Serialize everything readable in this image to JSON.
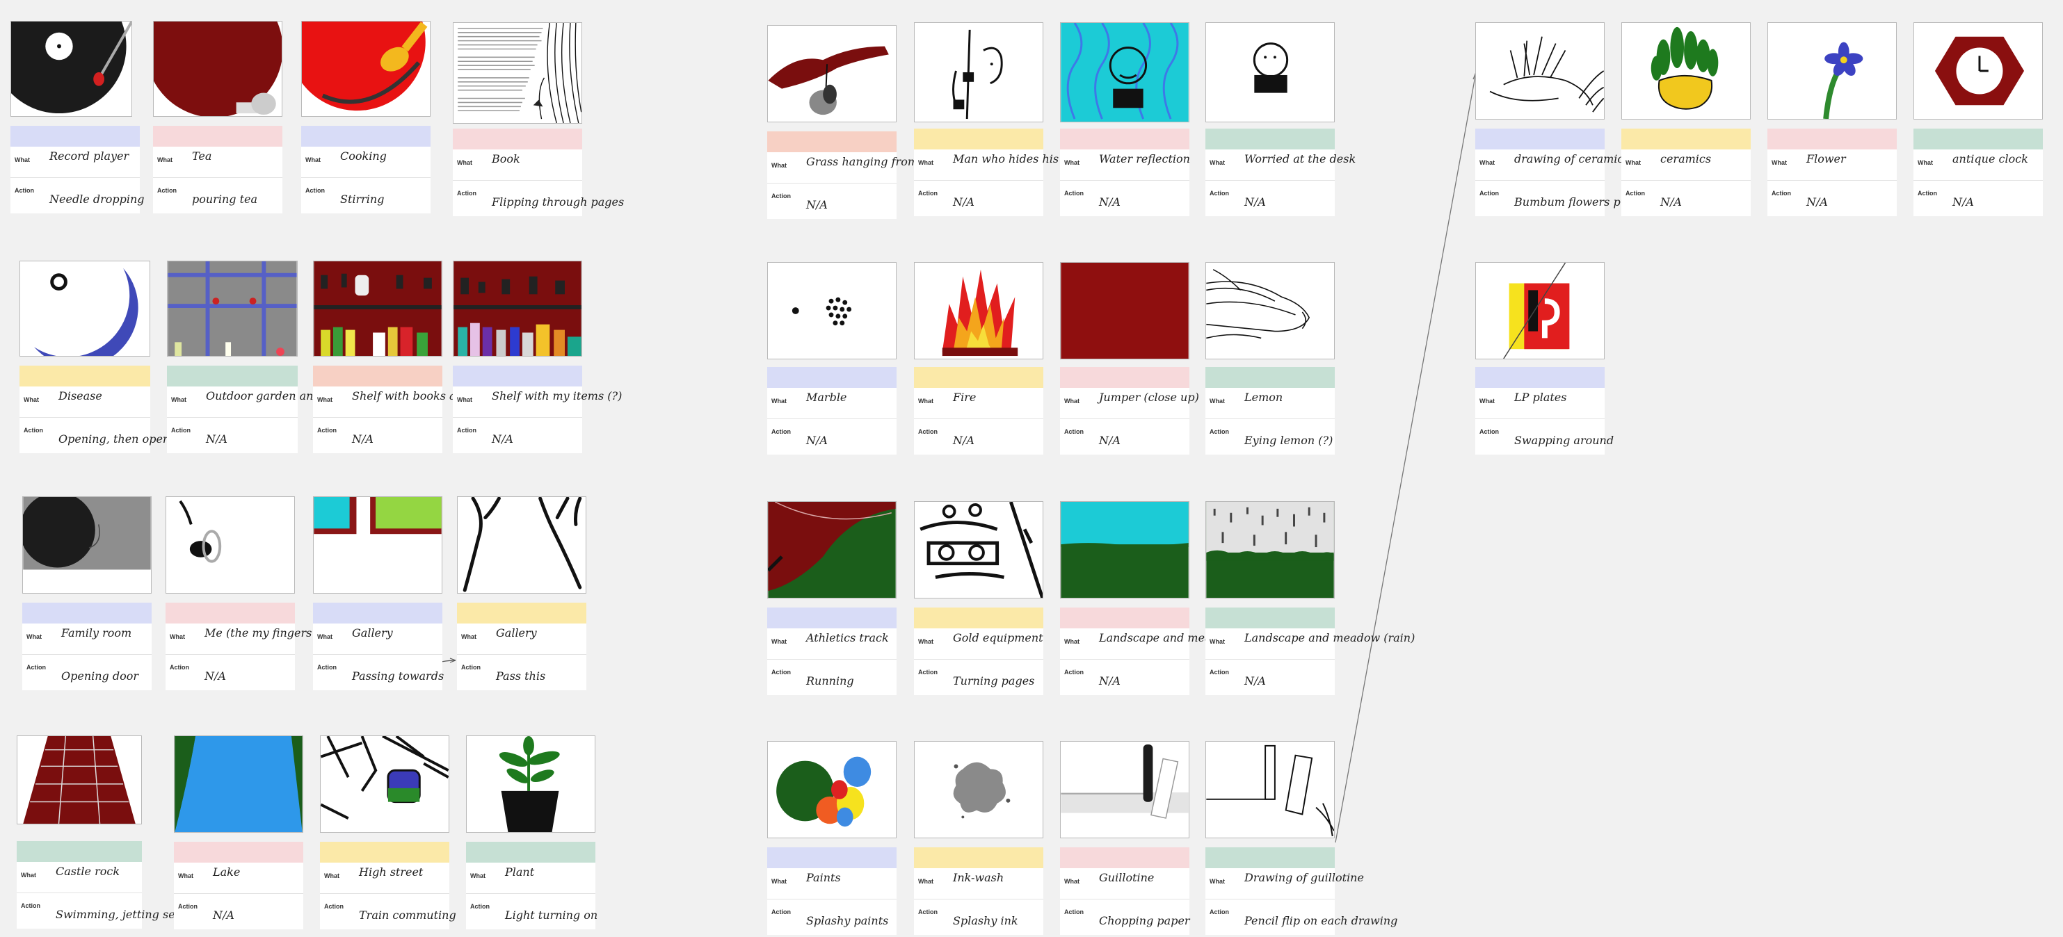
{
  "labels": {
    "what": "What",
    "action": "Action"
  },
  "colors": {
    "blue": "#d8dcf7",
    "pink": "#f7d9db",
    "yellow": "#fbe9a8",
    "green": "#c6e0d4",
    "salmon": "#f7d0c4",
    "maroon": "#8b0f0f",
    "canvas": "#f1f1f1"
  },
  "cards": [
    {
      "id": "c1",
      "what": "Record player",
      "action": "Needle dropping",
      "band": "blue",
      "icon": "record-player-drawing"
    },
    {
      "id": "c2",
      "what": "Tea",
      "action": "pouring tea",
      "band": "pink",
      "icon": "teapot-drawing"
    },
    {
      "id": "c3",
      "what": "Cooking",
      "action": "Stirring",
      "band": "blue",
      "icon": "cooking-pan-drawing"
    },
    {
      "id": "c4",
      "what": "Book",
      "action": "Flipping through pages",
      "band": "pink",
      "icon": "book-pages-drawing"
    },
    {
      "id": "c5",
      "what": "Disease",
      "action": "Opening, then opening brushy",
      "band": "yellow",
      "icon": "disease-drawing"
    },
    {
      "id": "c6",
      "what": "Outdoor garden and bag",
      "action": "N/A",
      "band": "green",
      "icon": "garden-shelf-drawing"
    },
    {
      "id": "c7",
      "what": "Shelf with books and bottles",
      "action": "N/A",
      "band": "salmon",
      "icon": "shelf-drawing"
    },
    {
      "id": "c8",
      "what": "Shelf with my items (?)",
      "action": "N/A",
      "band": "blue",
      "icon": "shelf-items-drawing"
    },
    {
      "id": "c9",
      "what": "Family room",
      "action": "Opening door",
      "band": "blue",
      "icon": "family-room-drawing"
    },
    {
      "id": "c10",
      "what": "Me (the my fingers (ring))",
      "action": "N/A",
      "band": "pink",
      "icon": "ear-drawing"
    },
    {
      "id": "c11",
      "what": "Gallery",
      "action": "Passing towards",
      "band": "blue",
      "icon": "gallery-drawing"
    },
    {
      "id": "c12",
      "what": "Gallery",
      "action": "Pass this",
      "band": "yellow",
      "icon": "gallery-lines-drawing"
    },
    {
      "id": "c13",
      "what": "Castle rock",
      "action": "Swimming, jetting sea/bubbles",
      "band": "green",
      "icon": "castle-rock-drawing"
    },
    {
      "id": "c14",
      "what": "Lake",
      "action": "N/A",
      "band": "pink",
      "icon": "lake-drawing"
    },
    {
      "id": "c15",
      "what": "High street",
      "action": "Train commuting",
      "band": "yellow",
      "icon": "high-street-drawing"
    },
    {
      "id": "c16",
      "what": "Plant",
      "action": "Light turning on",
      "band": "green",
      "icon": "plant-pot-drawing"
    },
    {
      "id": "c17",
      "what": "Grass hanging from tree",
      "action": "N/A",
      "band": "salmon",
      "icon": "hanging-tree-drawing"
    },
    {
      "id": "c18",
      "what": "Man who hides his face behind a hand",
      "action": "N/A",
      "band": "yellow",
      "icon": "hiding-face-drawing"
    },
    {
      "id": "c19",
      "what": "Water reflection",
      "action": "N/A",
      "band": "pink",
      "icon": "water-face-drawing"
    },
    {
      "id": "c20",
      "what": "Worried at the desk",
      "action": "N/A",
      "band": "green",
      "icon": "worried-person-drawing"
    },
    {
      "id": "c21",
      "what": "Marble",
      "action": "N/A",
      "band": "blue",
      "icon": "marbles-drawing"
    },
    {
      "id": "c22",
      "what": "Fire",
      "action": "N/A",
      "band": "yellow",
      "icon": "fire-drawing"
    },
    {
      "id": "c23",
      "what": "Jumper (close up)",
      "action": "N/A",
      "band": "pink",
      "icon": "jumper-drawing"
    },
    {
      "id": "c24",
      "what": "Lemon",
      "action": "Eying lemon (?)",
      "band": "green",
      "icon": "lemon-sketch-drawing"
    },
    {
      "id": "c25",
      "what": "Athletics track",
      "action": "Running",
      "band": "blue",
      "icon": "athletics-track-drawing"
    },
    {
      "id": "c26",
      "what": "Gold equipment",
      "action": "Turning pages",
      "band": "yellow",
      "icon": "equipment-drawing"
    },
    {
      "id": "c27",
      "what": "Landscape and meadow",
      "action": "N/A",
      "band": "pink",
      "icon": "landscape-drawing"
    },
    {
      "id": "c28",
      "what": "Landscape and meadow (rain)",
      "action": "N/A",
      "band": "green",
      "icon": "rain-landscape-drawing"
    },
    {
      "id": "c29",
      "what": "Paints",
      "action": "Splashy paints",
      "band": "blue",
      "icon": "paint-splash-drawing"
    },
    {
      "id": "c30",
      "what": "Ink-wash",
      "action": "Splashy ink",
      "band": "yellow",
      "icon": "ink-splash-drawing"
    },
    {
      "id": "c31",
      "what": "Guillotine",
      "action": "Chopping paper",
      "band": "pink",
      "icon": "guillotine-drawing"
    },
    {
      "id": "c32",
      "what": "Drawing of guillotine",
      "action": "Pencil flip on each drawing",
      "band": "green",
      "icon": "guillotine-sketch-drawing"
    },
    {
      "id": "c33",
      "what": "drawing of ceramics",
      "action": "Bumbum flowers puff",
      "band": "blue",
      "icon": "ceramics-sketch-drawing"
    },
    {
      "id": "c34",
      "what": "ceramics",
      "action": "N/A",
      "band": "yellow",
      "icon": "ceramics-plant-drawing"
    },
    {
      "id": "c35",
      "what": "Flower",
      "action": "N/A",
      "band": "pink",
      "icon": "flower-drawing"
    },
    {
      "id": "c36",
      "what": "antique clock",
      "action": "N/A",
      "band": "green",
      "icon": "clock-drawing"
    },
    {
      "id": "c37",
      "what": "LP plates",
      "action": "Swapping around",
      "band": "blue",
      "icon": "lp-plates-drawing"
    }
  ]
}
